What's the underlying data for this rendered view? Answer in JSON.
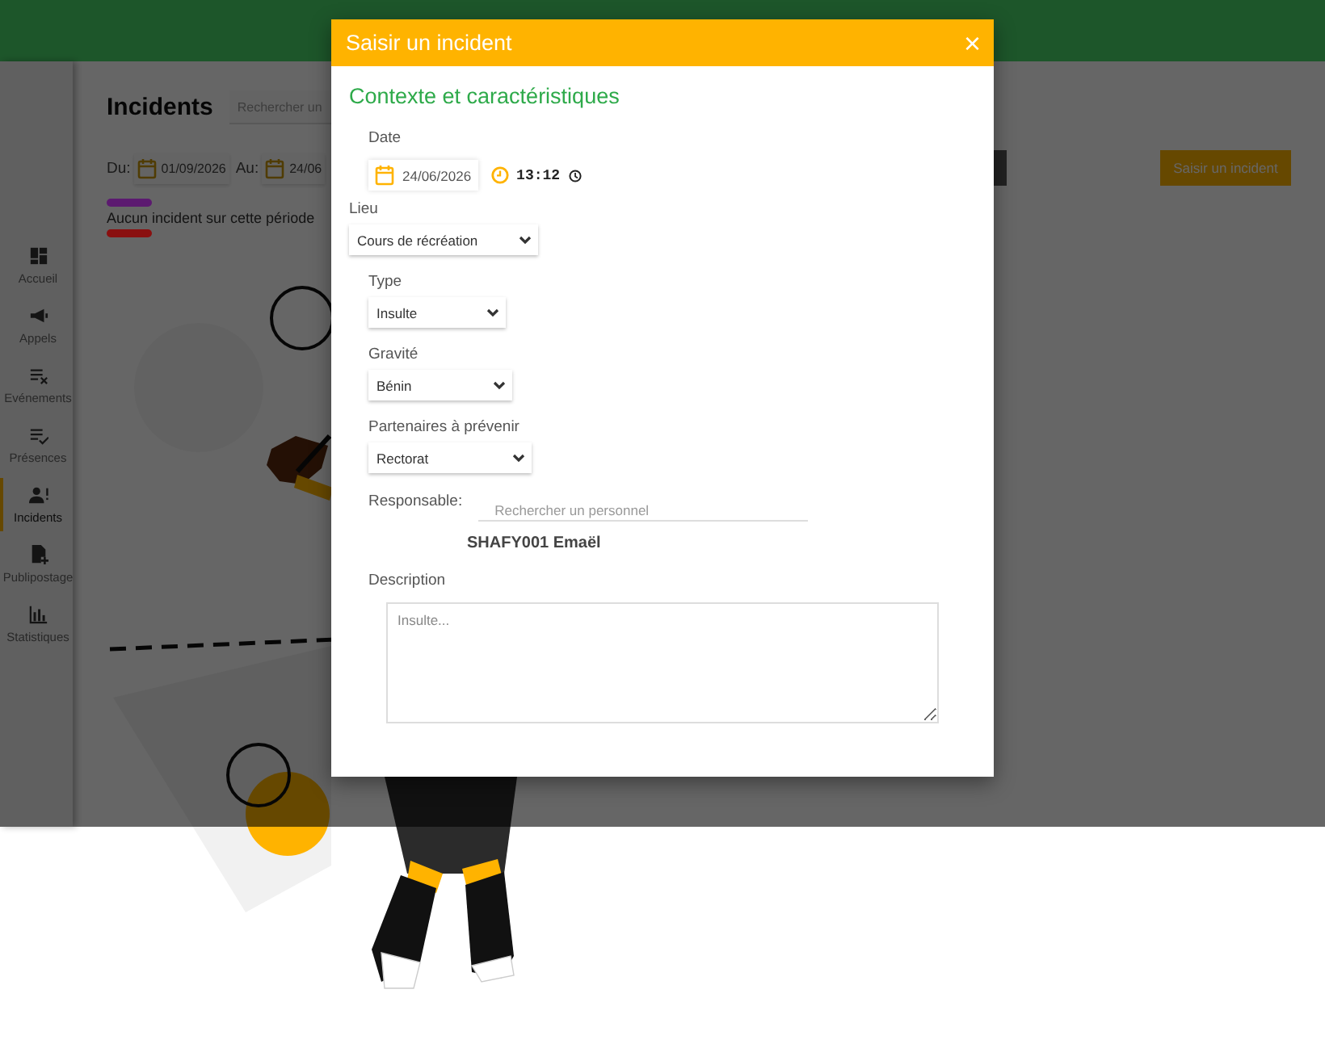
{
  "sidebar": {
    "items": [
      {
        "label": "Accueil",
        "selected": false
      },
      {
        "label": "Appels",
        "selected": false
      },
      {
        "label": "Evénements",
        "selected": false
      },
      {
        "label": "Présences",
        "selected": false
      },
      {
        "label": "Incidents",
        "selected": true
      },
      {
        "label": "Publipostage",
        "selected": false
      },
      {
        "label": "Statistiques",
        "selected": false
      }
    ]
  },
  "page": {
    "title": "Incidents",
    "search": {
      "placeholder": "Rechercher un"
    },
    "filters": {
      "from_label": "Du:",
      "from_date": "01/09/2026",
      "to_label": "Au:",
      "to_date": "24/06"
    },
    "action_button": "Saisir un incident",
    "legend": [
      {
        "color": "#5c1a70"
      },
      {
        "color": "#8a1010"
      }
    ],
    "empty_message": "Aucun incident sur cette période"
  },
  "dialog": {
    "title": "Saisir un incident",
    "close": "×",
    "section_title": "Contexte et caractéristiques",
    "date_label": "Date",
    "date": "24/06/2026",
    "time": "13:12",
    "place": {
      "label": "Lieu",
      "value": "Cours de récréation"
    },
    "fields": [
      {
        "label": "Type",
        "value": "Insulte"
      },
      {
        "label": "Gravité",
        "value": "Bénin"
      },
      {
        "label": "Partenaires à prévenir",
        "value": "Rectorat"
      }
    ],
    "responsible": {
      "label": "Responsable:",
      "placeholder": "Rechercher un personnel",
      "name": "SHAFY001 Emaël"
    },
    "description": {
      "label": "Description",
      "placeholder": "Insulte..."
    }
  }
}
